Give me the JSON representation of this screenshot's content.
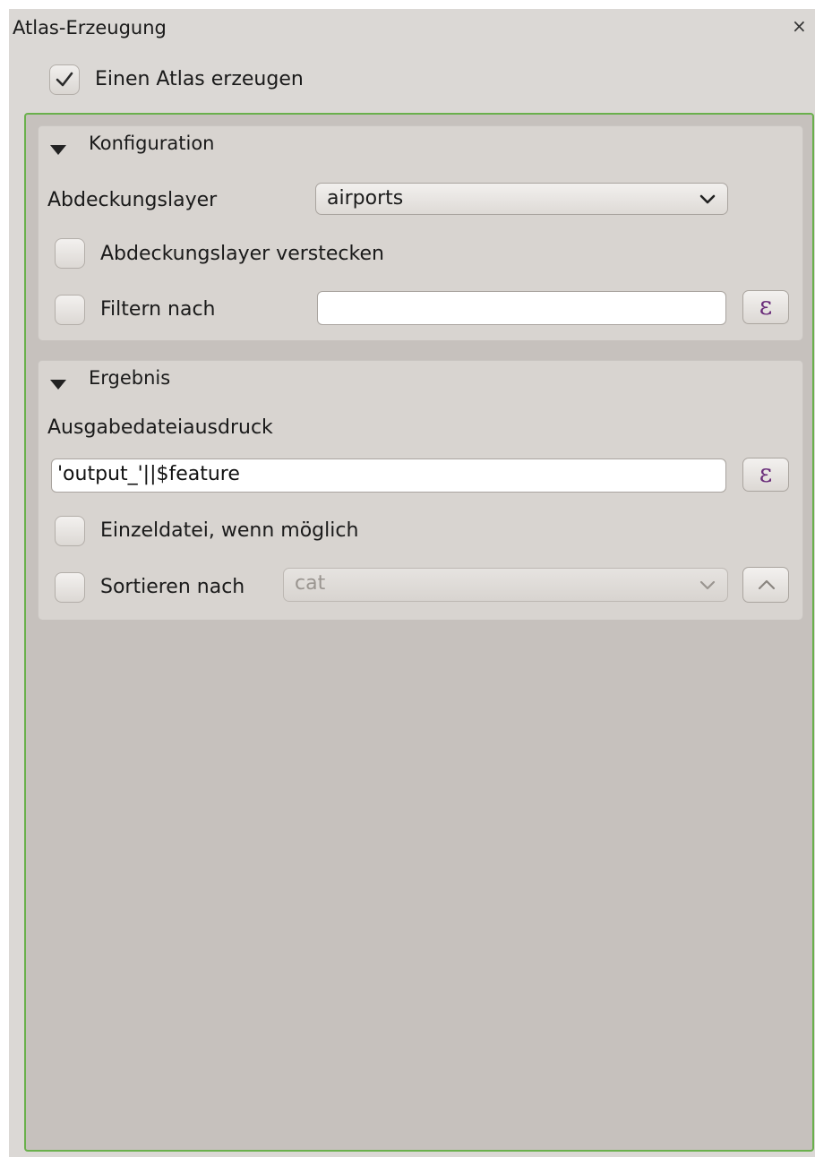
{
  "window": {
    "title": "Atlas-Erzeugung",
    "close_glyph": "×"
  },
  "generate_atlas": {
    "label": "Einen Atlas erzeugen",
    "checked": true
  },
  "configuration": {
    "title": "Konfiguration",
    "coverage_layer_label": "Abdeckungslayer",
    "coverage_layer_value": "airports",
    "hide_coverage_label": "Abdeckungslayer verstecken",
    "hide_coverage_checked": false,
    "filter_label": "Filtern nach",
    "filter_checked": false,
    "filter_value": "",
    "expression_glyph": "ε"
  },
  "output": {
    "title": "Ergebnis",
    "filename_expression_label": "Ausgabedateiausdruck",
    "filename_expression_value": "'output_'||$feature",
    "expression_glyph": "ε",
    "single_file_label": "Einzeldatei, wenn möglich",
    "single_file_checked": false,
    "sort_by_label": "Sortieren nach",
    "sort_by_checked": false,
    "sort_by_value": "cat"
  },
  "icons": {
    "close": "close-icon",
    "checkmark": "checkmark-icon",
    "collapse": "collapse-triangle-icon",
    "dropdown": "chevron-down-icon",
    "expression": "epsilon-expression-icon",
    "sort_order": "chevron-up-icon"
  },
  "colors": {
    "panel_background": "#dbd8d5",
    "frame_border": "#6ab04c",
    "frame_background": "#c6c1bd",
    "expression_icon": "#6a2d7a"
  }
}
